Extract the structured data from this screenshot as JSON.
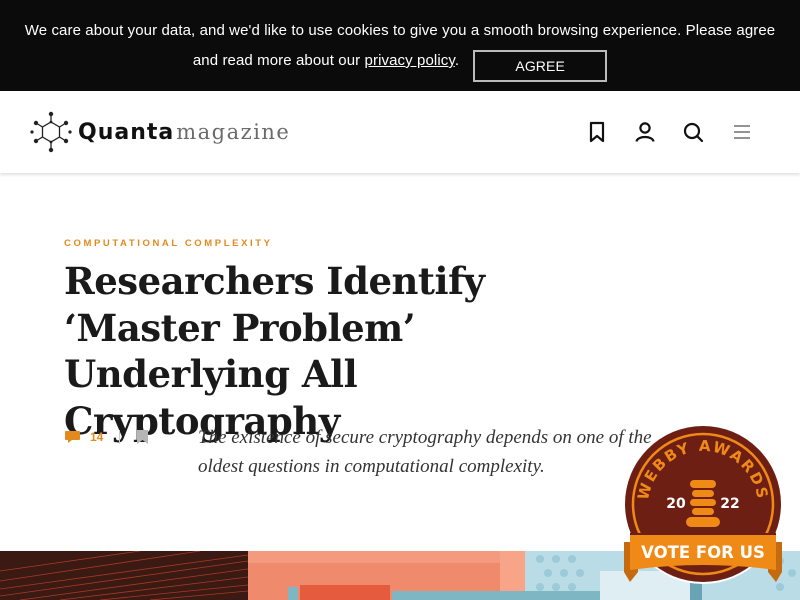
{
  "cookie_banner": {
    "text": "We care about your data, and we'd like to use cookies to give you a smooth browsing experience. Please agree and read more about our ",
    "link_label": "privacy policy",
    "after_link": ".",
    "agree_label": "AGREE"
  },
  "header": {
    "logo_primary": "Quanta",
    "logo_secondary": "magazine",
    "icons": [
      "bookmark-icon",
      "user-icon",
      "search-icon",
      "menu-icon"
    ]
  },
  "article": {
    "kicker": "COMPUTATIONAL COMPLEXITY",
    "title": "Researchers Identify ‘Master Problem’ Underlying All Cryptography",
    "comment_count": "14",
    "deck": "The existence of secure cryptography depends on one of the oldest questions in computational complexity."
  },
  "webby_badge": {
    "arc_text": "WEBBY AWARDS",
    "year_left": "20",
    "year_right": "22",
    "ribbon_label": "VOTE FOR US"
  },
  "colors": {
    "accent": "#e28a1d",
    "banner_bg": "#0b0b0b",
    "badge_maroon": "#6e1f14",
    "badge_orange": "#f08a17"
  }
}
